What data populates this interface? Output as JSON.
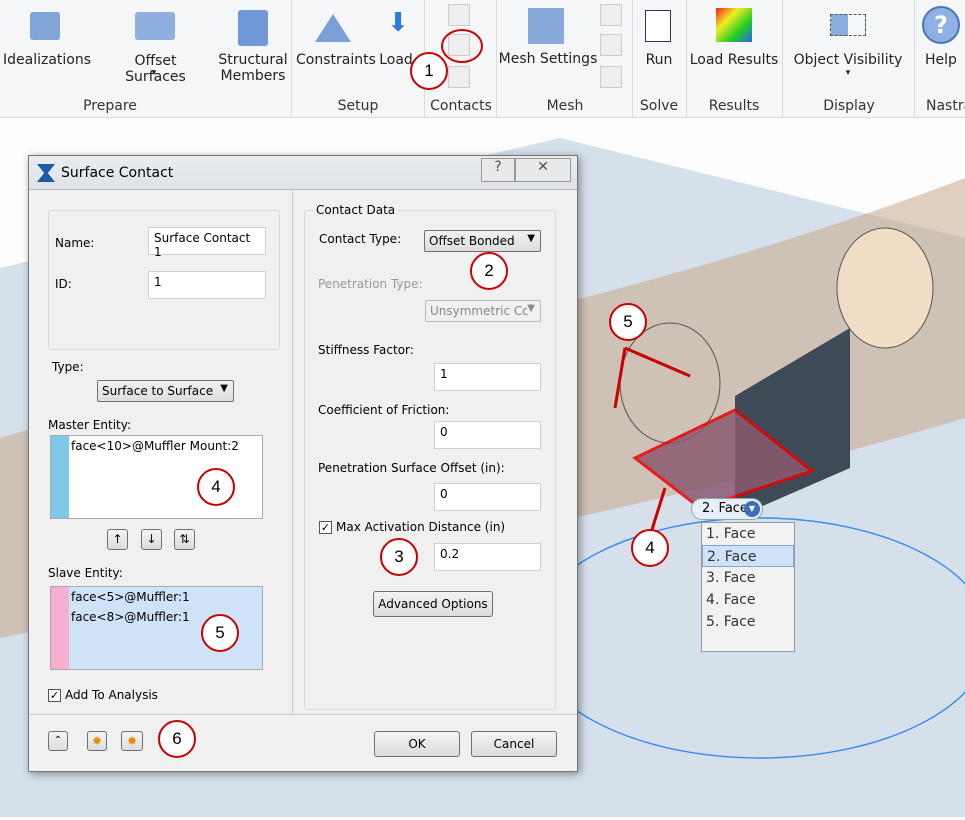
{
  "ribbon": {
    "buttons": [
      {
        "label": "Idealizations",
        "icon": "idealizations-icon"
      },
      {
        "label": "Offset Surfaces",
        "icon": "offset-surfaces-icon",
        "dropdown": true
      },
      {
        "label": "Structural Members",
        "icon": "structural-members-icon"
      },
      {
        "label": "Constraints",
        "icon": "constraints-icon"
      },
      {
        "label": "Load",
        "icon": "load-icon"
      },
      {
        "label": "Mesh Settings",
        "icon": "mesh-settings-icon"
      },
      {
        "label": "Run",
        "icon": "run-icon"
      },
      {
        "label": "Load Results",
        "icon": "load-results-icon"
      },
      {
        "label": "Object Visibility",
        "icon": "object-visibility-icon",
        "dropdown": true
      },
      {
        "label": "Help",
        "icon": "help-icon"
      }
    ],
    "groups": [
      "Prepare",
      "Setup",
      "Contacts",
      "Mesh",
      "Solve",
      "Results",
      "Display",
      "Nastra"
    ]
  },
  "dialog": {
    "title": "Surface Contact",
    "name_label": "Name:",
    "name_value": "Surface Contact 1",
    "id_label": "ID:",
    "id_value": "1",
    "type_label": "Type:",
    "type_value": "Surface to Surface",
    "master_label": "Master Entity:",
    "master_items": [
      "face<10>@Muffler Mount:2"
    ],
    "slave_label": "Slave Entity:",
    "slave_items": [
      "face<5>@Muffler:1",
      "face<8>@Muffler:1"
    ],
    "add_to_analysis": "Add To Analysis",
    "add_to_analysis_checked": true,
    "contact_data": "Contact Data",
    "contact_type_label": "Contact Type:",
    "contact_type_value": "Offset Bonded",
    "penetration_type_label": "Penetration Type:",
    "penetration_type_value": "Unsymmetric Co",
    "stiffness_label": "Stiffness Factor:",
    "stiffness_value": "1",
    "friction_label": "Coefficient of Friction:",
    "friction_value": "0",
    "offset_label": "Penetration Surface Offset (in):",
    "offset_value": "0",
    "max_act_label": "Max Activation Distance (in)",
    "max_act_checked": true,
    "max_act_value": "0.2",
    "advanced": "Advanced Options",
    "ok": "OK",
    "cancel": "Cancel",
    "master_color": "#7ec8e8",
    "slave_color": "#f5b0d0"
  },
  "viewport": {
    "face_selector": "2. Face",
    "face_options": [
      "1. Face",
      "2. Face",
      "3. Face",
      "4. Face",
      "5. Face"
    ],
    "selected_option": "2. Face"
  },
  "callouts": [
    "1",
    "2",
    "3",
    "4",
    "5",
    "6",
    "4",
    "5"
  ]
}
